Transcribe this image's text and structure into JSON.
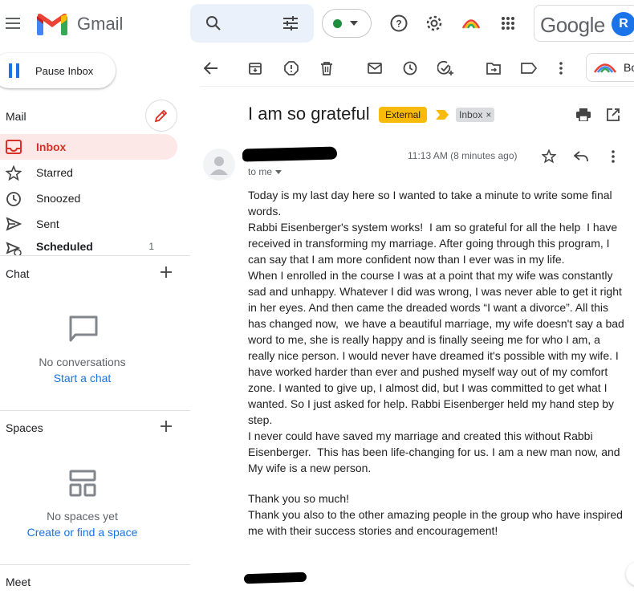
{
  "header": {
    "app_name": "Gmail",
    "google_word": "Google",
    "avatar_letter": "R",
    "status_color": "#1e8e3e"
  },
  "sidebar": {
    "pause_label": "Pause Inbox",
    "mail_heading": "Mail",
    "items": [
      {
        "label": "Inbox",
        "count": "",
        "active": true,
        "icon": "inbox-icon"
      },
      {
        "label": "Starred",
        "count": "",
        "icon": "star-icon"
      },
      {
        "label": "Snoozed",
        "count": "",
        "icon": "clock-icon"
      },
      {
        "label": "Sent",
        "count": "",
        "icon": "send-icon"
      },
      {
        "label": "Scheduled",
        "count": "1",
        "icon": "scheduled-send-icon"
      }
    ],
    "chat": {
      "heading": "Chat",
      "empty_text": "No conversations",
      "action": "Start a chat"
    },
    "spaces": {
      "heading": "Spaces",
      "empty_text": "No spaces yet",
      "action": "Create or find a space"
    },
    "meet_heading": "Meet"
  },
  "toolbar": {
    "addon_label": "Bo"
  },
  "message": {
    "subject": "I am so grateful",
    "external_label": "External",
    "inbox_label": "Inbox",
    "inbox_remove": "×",
    "time": "11:13 AM (8 minutes ago)",
    "to": "to me",
    "body": [
      "Today is my last day here so I wanted to take a minute to write some final words.",
      "Rabbi Eisenberger's system works!  I am so grateful for all the help  I have received in transforming my marriage. After going through this program, I can say that I am more confident now than I ever was in my life.",
      "When I enrolled in the course I was at a point that my wife was constantly sad and unhappy. Whatever I did was wrong, I was never able to get it right in her eyes. And then came the dreaded words “I want a divorce”. All this has changed now,  we have a beautiful marriage, my wife doesn't say a bad word to me, she is really happy and is finally seeing me for who I am, a really nice person. I would never have dreamed it's possible with my wife. I have worked harder than ever and pushed myself way out of my comfort zone. I wanted to give up, I almost did, but I was committed to get what I wanted. So I just asked for help. Rabbi Eisenberger held my hand step by step.",
      "I never could have saved my marriage and created this without Rabbi Eisenberger.  This has been life-changing for us. I am a new man now, and My wife is a new person."
    ],
    "closing": [
      "Thank you so much!",
      "Thank you also to the other amazing people in the group who have inspired me with their success stories and encouragement!"
    ]
  },
  "colors": {
    "gmail_red": "#d93025",
    "active_nav_bg": "#fce8e6",
    "external_badge": "#f9bb0a",
    "link_blue": "#1a73e8"
  }
}
